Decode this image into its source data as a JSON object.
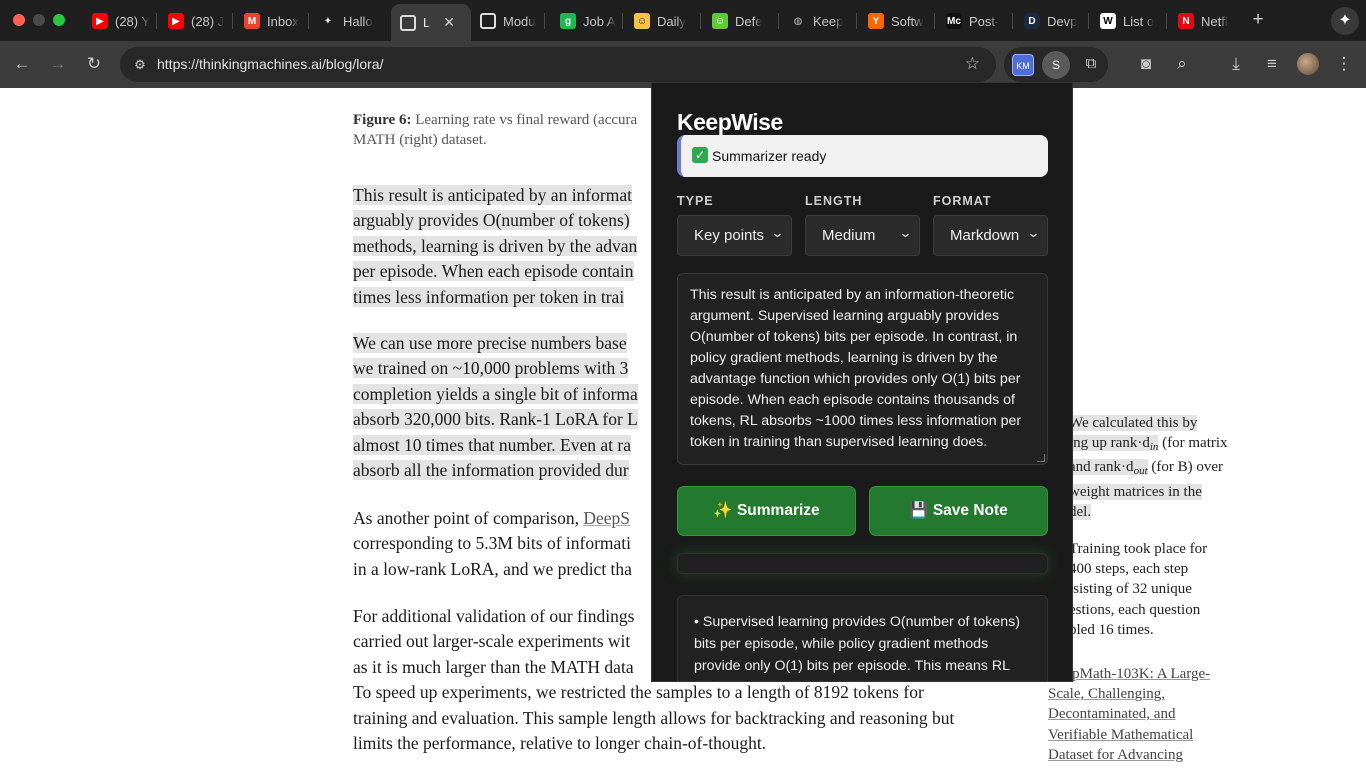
{
  "browser": {
    "tabs": [
      {
        "title": "(28) Y",
        "icon": "youtube-icon",
        "color": "#ff0000",
        "glyph": "▶"
      },
      {
        "title": "(28) J",
        "icon": "youtube-icon",
        "color": "#ff0000",
        "glyph": "▶"
      },
      {
        "title": "Inbox",
        "icon": "gmail-icon",
        "color": "#ea4335",
        "glyph": "M"
      },
      {
        "title": "Hallo",
        "icon": "sparkle-icon",
        "color": "#ffffff",
        "glyph": "✦"
      },
      {
        "title": "L",
        "icon": "page-icon",
        "color": "#dddddd",
        "glyph": "□",
        "active": true
      },
      {
        "title": "Modu",
        "icon": "page-icon",
        "color": "#dddddd",
        "glyph": "□"
      },
      {
        "title": "Job A",
        "icon": "job-icon",
        "color": "#1db954",
        "glyph": "g"
      },
      {
        "title": "Daily",
        "icon": "emoji-icon",
        "color": "#f6c343",
        "glyph": "☺"
      },
      {
        "title": "Defe",
        "icon": "emoji-icon",
        "color": "#62c83c",
        "glyph": "☺"
      },
      {
        "title": "Keep",
        "icon": "globe-icon",
        "color": "#bdbdbd",
        "glyph": "◍"
      },
      {
        "title": "Softw",
        "icon": "ycombinator-icon",
        "color": "#ff6600",
        "glyph": "Y"
      },
      {
        "title": "Post-",
        "icon": "mc-icon",
        "color": "#111111",
        "glyph": "Mc"
      },
      {
        "title": "Devp",
        "icon": "d-icon",
        "color": "#1b2a41",
        "glyph": "D"
      },
      {
        "title": "List o",
        "icon": "wikipedia-icon",
        "color": "#ffffff",
        "glyph": "W"
      },
      {
        "title": "Netfl",
        "icon": "netflix-icon",
        "color": "#e50914",
        "glyph": "N"
      }
    ],
    "url": "https://thinkingmachines.ai/blog/lora/",
    "profile_letter": "S",
    "extension_label": "KM"
  },
  "article": {
    "caption_label": "Figure 6:",
    "caption_rest": "Learning rate vs final reward (accura",
    "caption_line2": "MATH (right) dataset.",
    "para1": [
      "This result is anticipated by an informat",
      "arguably provides O(number of tokens)",
      "methods, learning is driven by the advan",
      "per episode. When each episode contain",
      "times less information per token in trai"
    ],
    "para2": [
      "We can use more precise numbers base",
      "we trained on ~10,000 problems with 3",
      "completion yields a single bit of informa",
      "absorb 320,000 bits. Rank-1 LoRA for L",
      "almost 10 times that number. Even at ra",
      "absorb all the information provided dur"
    ],
    "para3_prefix": "As another point of comparison,",
    "para3_link": "DeepS",
    "para3": [
      "corresponding to 5.3M bits of informati",
      "in a low-rank LoRA, and we predict tha"
    ],
    "para4": [
      "For additional validation of our findings",
      "carried out larger-scale experiments wit",
      "as it is much larger than the MATH data",
      "To speed up experiments, we restricted the samples to a length of 8192 tokens for",
      "training and evaluation. This sample length allows for backtracking and reasoning but",
      "limits the performance, relative to longer chain-of-thought."
    ],
    "side1": [
      "We calculated this by",
      "ing up rank·d",
      "and rank·d",
      "weight matrices in the",
      "del."
    ],
    "side1_sub_in": "in",
    "side1_sub_in_rest": " (for matrix",
    "side1_sub_out": "out",
    "side1_sub_out_rest": " (for B) over",
    "side2": [
      "Training took place for",
      "400 steps, each step",
      "isisting of 32 unique",
      "estions, each question",
      "pled 16 times."
    ],
    "side3": [
      "DeepMath-103K: A Large-",
      "Scale, Challenging,",
      "Decontaminated, and",
      "Verifiable Mathematical",
      "Dataset for Advancing"
    ]
  },
  "popup": {
    "title": "KeepWise",
    "status": "Summarizer ready",
    "type_label": "TYPE",
    "length_label": "LENGTH",
    "format_label": "FORMAT",
    "type_value": "Key points",
    "length_value": "Medium",
    "format_value": "Markdown",
    "input_text": "This result is anticipated by an information-theoretic argument. Supervised learning arguably provides O(number of tokens) bits per episode. In contrast, in policy gradient methods, learning is driven by the advantage function which provides only O(1) bits per episode. When each episode contains thousands of tokens, RL absorbs ~1000 times less information per token in training than supervised learning does.",
    "summarize_label": "✨ Summarize",
    "save_label": "💾 Save Note",
    "summary_text": "• Supervised learning provides O(number of tokens) bits per episode, while policy gradient methods provide only O(1) bits per episode. This means RL"
  }
}
